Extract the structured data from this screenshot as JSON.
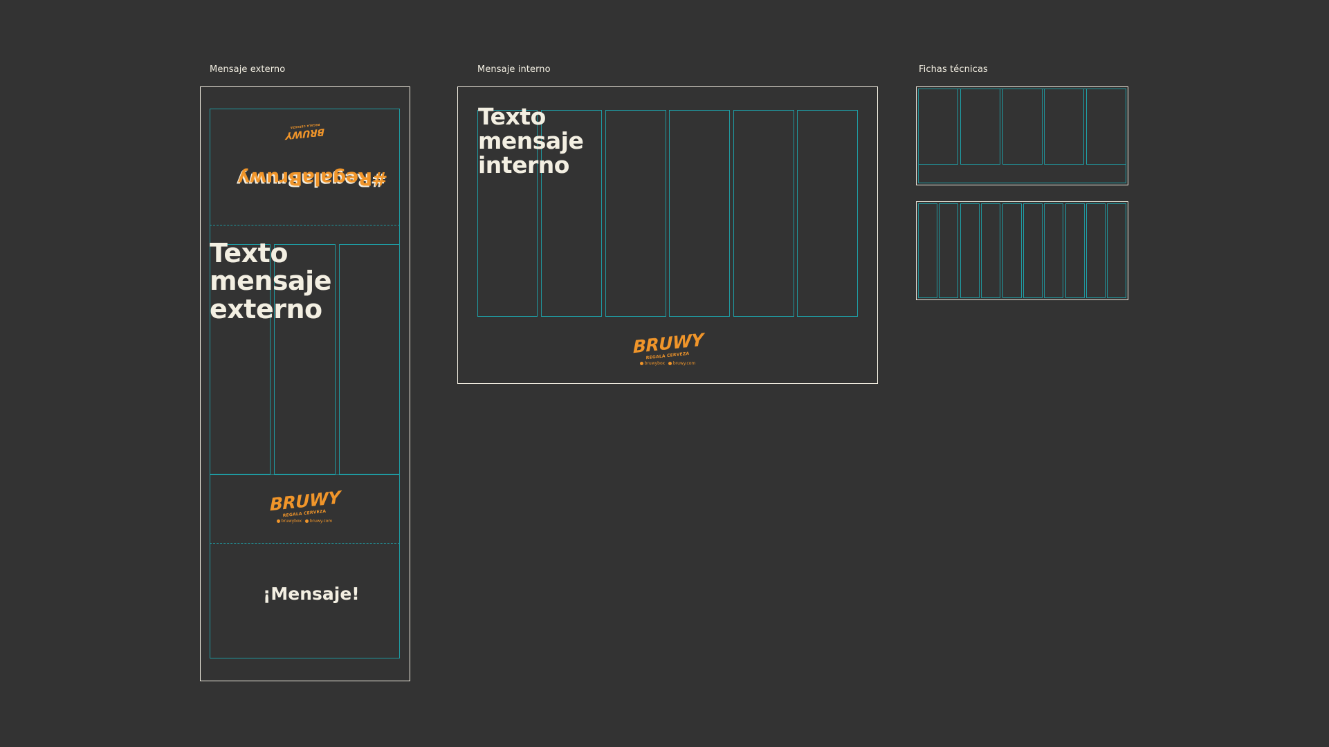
{
  "sections": {
    "externo": {
      "label": "Mensaje externo"
    },
    "interno": {
      "label": "Mensaje interno"
    },
    "fichas": {
      "label": "Fichas técnicas"
    }
  },
  "externo_panel": {
    "hashtag": "#RegalaBruwy",
    "big_text": "Texto\nmensaje\nexterno",
    "message": "¡Mensaje!"
  },
  "interno_panel": {
    "big_text": "Texto\nmensaje\ninterno"
  },
  "logo": {
    "brand": "BRUWY",
    "tagline": "REGALA CERVEZA",
    "instagram": "bruwybox",
    "website": "bruwy.com"
  },
  "colors": {
    "background": "#333333",
    "frame": "#f3efe2",
    "guide": "#1f9aa1",
    "accent": "#f0952a"
  },
  "icons": [
    "instagram-icon",
    "globe-icon"
  ]
}
